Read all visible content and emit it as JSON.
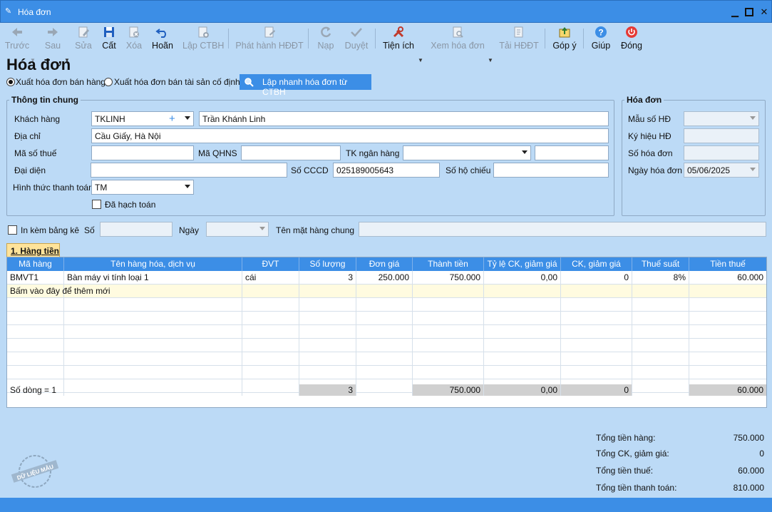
{
  "window": {
    "title": "Hóa đơn"
  },
  "toolbar": {
    "prev": "Trước",
    "next": "Sau",
    "edit": "Sửa",
    "save": "Cất",
    "delete": "Xóa",
    "undo": "Hoãn",
    "create_ctbh": "Lập CTBH",
    "issue_einvoice": "Phát hành HĐĐT",
    "load": "Nạp",
    "approve": "Duyệt",
    "utilities": "Tiện ích",
    "view_invoice": "Xem hóa đơn",
    "download_einvoice": "Tải HĐĐT",
    "feedback": "Góp ý",
    "help": "Giúp",
    "close": "Đóng"
  },
  "page": {
    "heading": "Hóa đơn",
    "radio_sales": "Xuất hóa đơn bán hàng",
    "radio_assets": "Xuất hóa đơn bán tài sản cố định",
    "quick_button": "Lập nhanh hóa đơn từ CTBH"
  },
  "general": {
    "title": "Thông tin chung",
    "customer_label": "Khách hàng",
    "customer_code": "TKLINH",
    "customer_name": "Trần Khánh Linh",
    "address_label": "Địa chỉ",
    "address": "Cầu Giấy, Hà Nội",
    "tax_code_label": "Mã số thuế",
    "tax_code": "",
    "qhns_label": "Mã QHNS",
    "qhns": "",
    "bank_label": "TK ngân hàng",
    "bank": "",
    "bank_extra": "",
    "rep_label": "Đại diện",
    "rep": "",
    "cccd_label": "Số CCCD",
    "cccd": "025189005643",
    "passport_label": "Số hộ chiếu",
    "passport": "",
    "payment_label": "Hình thức thanh toán",
    "payment": "TM",
    "posted_label": "Đã hạch toán"
  },
  "invoice": {
    "title": "Hóa đơn",
    "template_label": "Mẫu số HĐ",
    "template": "",
    "symbol_label": "Ký hiệu HĐ",
    "symbol": "",
    "number_label": "Số hóa đơn",
    "number": "",
    "date_label": "Ngày hóa đơn",
    "date": "05/06/2025"
  },
  "attach": {
    "print_list_label": "In kèm bảng kê",
    "no_label": "Số",
    "no": "",
    "date_label": "Ngày",
    "date": "",
    "common_name_label": "Tên mặt hàng chung",
    "common_name": ""
  },
  "tab": {
    "label": "1. Hàng tiền"
  },
  "grid": {
    "columns": [
      "Mã hàng",
      "Tên hàng hóa, dịch vụ",
      "ĐVT",
      "Số lượng",
      "Đơn giá",
      "Thành tiền",
      "Tỷ lệ CK, giảm giá",
      "CK, giảm giá",
      "Thuế suất",
      "Tiền thuế"
    ],
    "rows": [
      [
        "BMVT1",
        "Bàn máy vi tính loại 1",
        "cái",
        "3",
        "250.000",
        "750.000",
        "0,00",
        "0",
        "8%",
        "60.000"
      ]
    ],
    "add_new": "Bấm vào đây để thêm mới",
    "footer": [
      "Số dòng = 1",
      "",
      "",
      "3",
      "",
      "750.000",
      "0,00",
      "0",
      "",
      "60.000"
    ]
  },
  "totals": {
    "goods_label": "Tổng tiền hàng:",
    "goods": "750.000",
    "discount_label": "Tổng CK, giảm giá:",
    "discount": "0",
    "tax_label": "Tổng tiền thuế:",
    "tax": "60.000",
    "payment_label": "Tổng tiền thanh toán:",
    "payment": "810.000"
  },
  "stamp": "DỮ LIỆU MẪU"
}
